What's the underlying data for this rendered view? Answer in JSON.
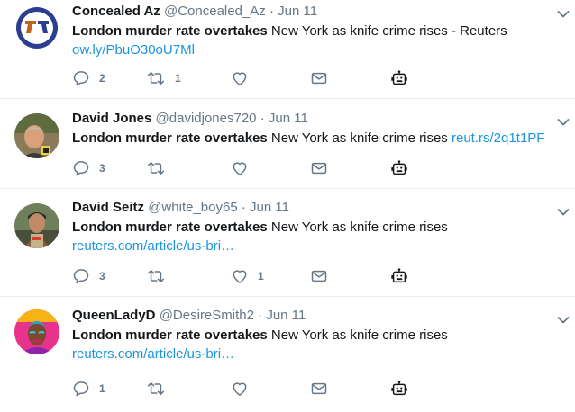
{
  "tweets": [
    {
      "fullname": "Concealed Az",
      "handle": "@Concealed_Az",
      "separator": "·",
      "time": "Jun 11",
      "headline": "London murder rate overtakes",
      "text": " New York as knife crime rises - Reuters",
      "link": "ow.ly/PbuO30oU7Ml",
      "counts": {
        "reply": "2",
        "retweet": "1",
        "like": ""
      }
    },
    {
      "fullname": "David Jones",
      "handle": "@davidjones720",
      "separator": "·",
      "time": "Jun 11",
      "headline": "London murder rate overtakes",
      "text": " New York as knife crime rises ",
      "link": "reut.rs/2q1t1PF",
      "counts": {
        "reply": "3",
        "retweet": "",
        "like": ""
      }
    },
    {
      "fullname": "David Seitz",
      "handle": "@white_boy65",
      "separator": "·",
      "time": "Jun 11",
      "headline": "London murder rate overtakes",
      "text": " New York as knife crime rises",
      "link": "reuters.com/article/us-bri…",
      "counts": {
        "reply": "3",
        "retweet": "",
        "like": "1"
      }
    },
    {
      "fullname": "QueenLadyD",
      "handle": "@DesireSmith2",
      "separator": "·",
      "time": "Jun 11",
      "headline": "London murder rate overtakes",
      "text": " New York as knife crime rises",
      "link": "reuters.com/article/us-bri…",
      "counts": {
        "reply": "1",
        "retweet": "",
        "like": ""
      }
    }
  ],
  "icons": {
    "reply": "reply-icon",
    "retweet": "retweet-icon",
    "like": "heart-icon",
    "dm": "envelope-icon",
    "bot": "robot-icon",
    "caret": "chevron-down-icon"
  },
  "colors": {
    "link": "#1b95e0",
    "secondary": "#657786",
    "text": "#14171a",
    "divider": "#e6ecf0"
  }
}
